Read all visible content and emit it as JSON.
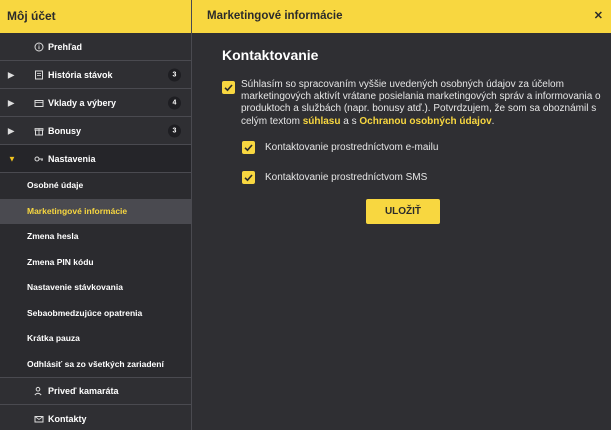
{
  "sidebar": {
    "title": "Môj účet",
    "items": [
      {
        "label": "Prehľad"
      },
      {
        "label": "História stávok",
        "badge": "3"
      },
      {
        "label": "Vklady a výbery",
        "badge": "4"
      },
      {
        "label": "Bonusy",
        "badge": "3"
      },
      {
        "label": "Nastavenia"
      }
    ],
    "settings_sub": [
      "Osobné údaje",
      "Marketingové informácie",
      "Zmena hesla",
      "Zmena PIN kódu",
      "Nastavenie stávkovania",
      "Sebaobmedzujúce opatrenia",
      "Krátka pauza",
      "Odhlásiť sa zo všetkých zariadení"
    ],
    "bottom": [
      {
        "label": "Priveď kamaráta"
      },
      {
        "label": "Kontakty"
      }
    ]
  },
  "main": {
    "title": "Marketingové informácie",
    "close": "✕",
    "section_title": "Kontaktovanie",
    "consent": {
      "text_before": "Súhlasím so spracovaním vyššie uvedených osobných údajov za účelom marketingových aktivít vrátane posielania marketingových správ a informovania o produktoch a službách (napr. bonusy atď.). Potvrdzujem, že som sa oboznámil s celým textom ",
      "link1": "súhlasu",
      "text_mid": " a s ",
      "link2": "Ochranou osobných údajov",
      "text_after": ".",
      "checked": true
    },
    "options": [
      {
        "label": "Kontaktovanie prostredníctvom e-mailu",
        "checked": true
      },
      {
        "label": "Kontaktovanie prostredníctvom SMS",
        "checked": true
      }
    ],
    "save_label": "ULOŽIŤ"
  },
  "colors": {
    "accent": "#f8d740",
    "background": "#2f2f33"
  }
}
